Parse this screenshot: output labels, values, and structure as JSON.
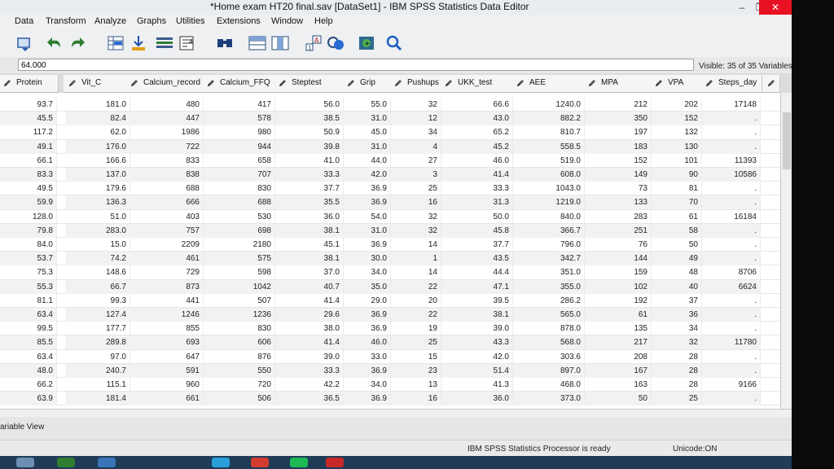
{
  "window": {
    "title": "*Home exam HT20 final.sav [DataSet1] - IBM SPSS Statistics Data Editor",
    "minimize": "–",
    "restore": "❐",
    "close": "✕"
  },
  "menus": [
    "Data",
    "Transform",
    "Analyze",
    "Graphs",
    "Utilities",
    "Extensions",
    "Window",
    "Help"
  ],
  "cell_editor": {
    "value": "64.000",
    "visible_vars": "Visible: 35 of 35 Variables"
  },
  "columns": [
    {
      "name": "Protein"
    },
    {
      "name": "Vit_C"
    },
    {
      "name": "Calcium_record"
    },
    {
      "name": "Calcium_FFQ"
    },
    {
      "name": "Steptest"
    },
    {
      "name": "Grip"
    },
    {
      "name": "Pushups"
    },
    {
      "name": "UKK_test"
    },
    {
      "name": "AEE"
    },
    {
      "name": "MPA"
    },
    {
      "name": "VPA"
    },
    {
      "name": "Steps_day"
    }
  ],
  "rows": [
    [
      "93.7",
      "181.0",
      "480",
      "417",
      "56.0",
      "55.0",
      "32",
      "66.6",
      "1240.0",
      "212",
      "202",
      "17148"
    ],
    [
      "45.5",
      "82.4",
      "447",
      "578",
      "38.5",
      "31.0",
      "12",
      "43.0",
      "882.2",
      "350",
      "152",
      "."
    ],
    [
      "117.2",
      "62.0",
      "1986",
      "980",
      "50.9",
      "45.0",
      "34",
      "65.2",
      "810.7",
      "197",
      "132",
      "."
    ],
    [
      "49.1",
      "176.0",
      "722",
      "944",
      "39.8",
      "31.0",
      "4",
      "45.2",
      "558.5",
      "183",
      "130",
      "."
    ],
    [
      "66.1",
      "166.6",
      "833",
      "658",
      "41.0",
      "44.0",
      "27",
      "46.0",
      "519.0",
      "152",
      "101",
      "11393"
    ],
    [
      "83.3",
      "137.0",
      "838",
      "707",
      "33.3",
      "42.0",
      "3",
      "41.4",
      "608.0",
      "149",
      "90",
      "10586"
    ],
    [
      "49.5",
      "179.6",
      "688",
      "830",
      "37.7",
      "36.9",
      "25",
      "33.3",
      "1043.0",
      "73",
      "81",
      "."
    ],
    [
      "59.9",
      "136.3",
      "666",
      "688",
      "35.5",
      "36.9",
      "16",
      "31.3",
      "1219.0",
      "133",
      "70",
      "."
    ],
    [
      "128.0",
      "51.0",
      "403",
      "530",
      "36.0",
      "54.0",
      "32",
      "50.0",
      "840.0",
      "283",
      "61",
      "16184"
    ],
    [
      "79.8",
      "283.0",
      "757",
      "698",
      "38.1",
      "31.0",
      "32",
      "45.8",
      "366.7",
      "251",
      "58",
      "."
    ],
    [
      "84.0",
      "15.0",
      "2209",
      "2180",
      "45.1",
      "36.9",
      "14",
      "37.7",
      "796.0",
      "76",
      "50",
      "."
    ],
    [
      "53.7",
      "74.2",
      "461",
      "575",
      "38.1",
      "30.0",
      "1",
      "43.5",
      "342.7",
      "144",
      "49",
      "."
    ],
    [
      "75.3",
      "148.6",
      "729",
      "598",
      "37.0",
      "34.0",
      "14",
      "44.4",
      "351.0",
      "159",
      "48",
      "8706"
    ],
    [
      "55.3",
      "66.7",
      "873",
      "1042",
      "40.7",
      "35.0",
      "22",
      "47.1",
      "355.0",
      "102",
      "40",
      "6624"
    ],
    [
      "81.1",
      "99.3",
      "441",
      "507",
      "41.4",
      "29.0",
      "20",
      "39.5",
      "286.2",
      "192",
      "37",
      "."
    ],
    [
      "63.4",
      "127.4",
      "1246",
      "1236",
      "29.6",
      "36.9",
      "22",
      "38.1",
      "565.0",
      "61",
      "36",
      "."
    ],
    [
      "99.5",
      "177.7",
      "855",
      "830",
      "38.0",
      "36.9",
      "19",
      "39.0",
      "878.0",
      "135",
      "34",
      "."
    ],
    [
      "85.5",
      "289.8",
      "693",
      "606",
      "41.4",
      "46.0",
      "25",
      "43.3",
      "568.0",
      "217",
      "32",
      "11780"
    ],
    [
      "63.4",
      "97.0",
      "647",
      "876",
      "39.0",
      "33.0",
      "15",
      "42.0",
      "303.6",
      "208",
      "28",
      "."
    ],
    [
      "48.0",
      "240.7",
      "591",
      "550",
      "33.3",
      "36.9",
      "23",
      "51.4",
      "897.0",
      "167",
      "28",
      "."
    ],
    [
      "66.2",
      "115.1",
      "960",
      "720",
      "42.2",
      "34.0",
      "13",
      "41.3",
      "468.0",
      "163",
      "28",
      "9166"
    ],
    [
      "63.9",
      "181.4",
      "661",
      "506",
      "36.5",
      "36.9",
      "16",
      "36.0",
      "373.0",
      "50",
      "25",
      "."
    ]
  ],
  "view_tab": "ariable View",
  "status": {
    "processor": "IBM SPSS Statistics Processor is ready",
    "encoding": "Unicode:ON"
  },
  "icons": [
    "open-data-icon",
    "undo-icon",
    "redo-icon",
    "goto-case-icon",
    "goto-variable-icon",
    "variables-icon",
    "run-descriptives-icon",
    "find-icon",
    "insert-cases-icon",
    "insert-variable-icon",
    "split-file-icon",
    "weight-cases-icon",
    "select-cases-icon",
    "value-labels-icon",
    "use-sets-icon",
    "search-icon"
  ]
}
